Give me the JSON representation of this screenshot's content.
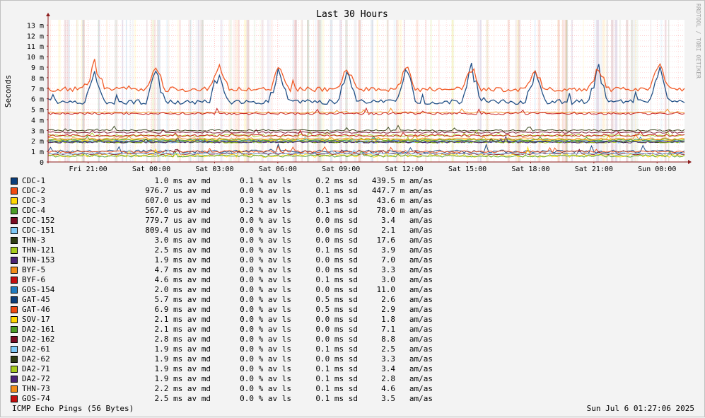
{
  "footer": {
    "left": "ICMP Echo Pings (56 Bytes)",
    "right": "Sun Jul  6 01:27:06 2025"
  },
  "colors": {
    "background": "#f3f3f3",
    "plot_bg": "#ffffff",
    "grid": "#ff9999",
    "axis": "#8b1a1a"
  },
  "chart_data": {
    "type": "line",
    "title": "Last 30 Hours",
    "ylabel": "Seconds",
    "watermark": "RRDTOOL / TOBI OETIKER",
    "ylim": [
      0,
      13.5
    ],
    "y_ticks": [
      {
        "v": 0,
        "label": "0"
      },
      {
        "v": 1,
        "label": "1 m"
      },
      {
        "v": 2,
        "label": "2 m"
      },
      {
        "v": 3,
        "label": "3 m"
      },
      {
        "v": 4,
        "label": "4 m"
      },
      {
        "v": 5,
        "label": "5 m"
      },
      {
        "v": 6,
        "label": "6 m"
      },
      {
        "v": 7,
        "label": "7 m"
      },
      {
        "v": 8,
        "label": "8 m"
      },
      {
        "v": 9,
        "label": "9 m"
      },
      {
        "v": 10,
        "label": "10 m"
      },
      {
        "v": 11,
        "label": "11 m"
      },
      {
        "v": 12,
        "label": "12 m"
      },
      {
        "v": 13,
        "label": "13 m"
      }
    ],
    "xlim": [
      -1.9,
      28.3
    ],
    "x_ticks": [
      {
        "v": 0,
        "label": "Fri 21:00"
      },
      {
        "v": 3,
        "label": "Sat 00:00"
      },
      {
        "v": 6,
        "label": "Sat 03:00"
      },
      {
        "v": 9,
        "label": "Sat 06:00"
      },
      {
        "v": 12,
        "label": "Sat 09:00"
      },
      {
        "v": 15,
        "label": "Sat 12:00"
      },
      {
        "v": 18,
        "label": "Sat 15:00"
      },
      {
        "v": 21,
        "label": "Sat 18:00"
      },
      {
        "v": 24,
        "label": "Sat 21:00"
      },
      {
        "v": 27,
        "label": "Sun 00:00"
      }
    ],
    "series": [
      {
        "name": "CDC-1",
        "color": "#0b3e7a",
        "median": "1.0 ms av md",
        "loss": "0.1 % av ls",
        "sd": "0.2 ms sd",
        "amas": "439.5 m am/as"
      },
      {
        "name": "CDC-2",
        "color": "#f04a11",
        "median": "976.7 us av md",
        "loss": "0.0 % av ls",
        "sd": "0.1 ms sd",
        "amas": "447.7 m am/as"
      },
      {
        "name": "CDC-3",
        "color": "#ffd700",
        "median": "607.0 us av md",
        "loss": "0.3 % av ls",
        "sd": "0.3 ms sd",
        "amas": "43.6 m am/as"
      },
      {
        "name": "CDC-4",
        "color": "#4b9d26",
        "median": "567.0 us av md",
        "loss": "0.2 % av ls",
        "sd": "0.1 ms sd",
        "amas": "78.0 m am/as"
      },
      {
        "name": "CDC-152",
        "color": "#7a0b23",
        "median": "779.7 us av md",
        "loss": "0.0 % av ls",
        "sd": "0.0 ms sd",
        "amas": "3.4   am/as"
      },
      {
        "name": "CDC-151",
        "color": "#7ec8f5",
        "median": "809.4 us av md",
        "loss": "0.0 % av ls",
        "sd": "0.0 ms sd",
        "amas": "2.1   am/as"
      },
      {
        "name": "THN-3",
        "color": "#2f3d13",
        "median": "3.0 ms av md",
        "loss": "0.0 % av ls",
        "sd": "0.0 ms sd",
        "amas": "17.6   am/as"
      },
      {
        "name": "THN-121",
        "color": "#a6cc1c",
        "median": "2.5 ms av md",
        "loss": "0.0 % av ls",
        "sd": "0.1 ms sd",
        "amas": "3.9   am/as"
      },
      {
        "name": "THN-153",
        "color": "#4a2375",
        "median": "1.9 ms av md",
        "loss": "0.0 % av ls",
        "sd": "0.0 ms sd",
        "amas": "7.0   am/as"
      },
      {
        "name": "BYF-5",
        "color": "#f28c17",
        "median": "4.7 ms av md",
        "loss": "0.0 % av ls",
        "sd": "0.0 ms sd",
        "amas": "3.3   am/as"
      },
      {
        "name": "BYF-6",
        "color": "#c40f0f",
        "median": "4.6 ms av md",
        "loss": "0.0 % av ls",
        "sd": "0.1 ms sd",
        "amas": "3.0   am/as"
      },
      {
        "name": "GOS-154",
        "color": "#1f7bbf",
        "median": "2.0 ms av md",
        "loss": "0.0 % av ls",
        "sd": "0.0 ms sd",
        "amas": "11.0   am/as"
      },
      {
        "name": "GAT-45",
        "color": "#0b3e7a",
        "median": "5.7 ms av md",
        "loss": "0.0 % av ls",
        "sd": "0.5 ms sd",
        "amas": "2.6   am/as"
      },
      {
        "name": "GAT-46",
        "color": "#f04a11",
        "median": "6.9 ms av md",
        "loss": "0.0 % av ls",
        "sd": "0.5 ms sd",
        "amas": "2.9   am/as"
      },
      {
        "name": "SOV-17",
        "color": "#ffd700",
        "median": "2.1 ms av md",
        "loss": "0.0 % av ls",
        "sd": "0.0 ms sd",
        "amas": "1.8   am/as"
      },
      {
        "name": "DA2-161",
        "color": "#4b9d26",
        "median": "2.1 ms av md",
        "loss": "0.0 % av ls",
        "sd": "0.0 ms sd",
        "amas": "7.1   am/as"
      },
      {
        "name": "DA2-162",
        "color": "#7a0b23",
        "median": "2.8 ms av md",
        "loss": "0.0 % av ls",
        "sd": "0.0 ms sd",
        "amas": "8.8   am/as"
      },
      {
        "name": "DA2-61",
        "color": "#7ec8f5",
        "median": "1.9 ms av md",
        "loss": "0.0 % av ls",
        "sd": "0.1 ms sd",
        "amas": "2.5   am/as"
      },
      {
        "name": "DA2-62",
        "color": "#2f3d13",
        "median": "1.9 ms av md",
        "loss": "0.0 % av ls",
        "sd": "0.0 ms sd",
        "amas": "3.3   am/as"
      },
      {
        "name": "DA2-71",
        "color": "#a6cc1c",
        "median": "1.9 ms av md",
        "loss": "0.0 % av ls",
        "sd": "0.1 ms sd",
        "amas": "3.4   am/as"
      },
      {
        "name": "DA2-72",
        "color": "#4a2375",
        "median": "1.9 ms av md",
        "loss": "0.0 % av ls",
        "sd": "0.1 ms sd",
        "amas": "2.8   am/as"
      },
      {
        "name": "THN-73",
        "color": "#f28c17",
        "median": "2.2 ms av md",
        "loss": "0.0 % av ls",
        "sd": "0.1 ms sd",
        "amas": "4.6   am/as"
      },
      {
        "name": "GOS-74",
        "color": "#c40f0f",
        "median": "2.5 ms av md",
        "loss": "0.0 % av ls",
        "sd": "0.1 ms sd",
        "amas": "3.5   am/as"
      }
    ]
  }
}
